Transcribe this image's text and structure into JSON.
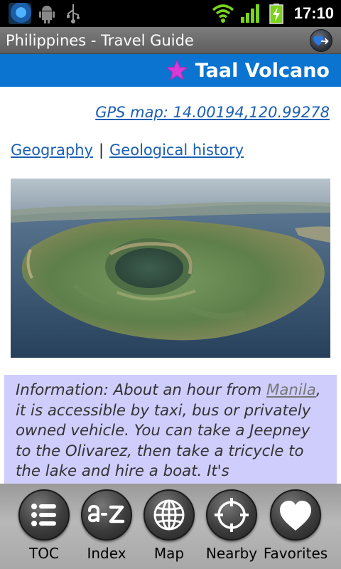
{
  "status_bar": {
    "time": "17:10",
    "icons": [
      "app-globe-icon",
      "android-debug-icon",
      "usb-icon",
      "wifi-icon",
      "signal-icon",
      "battery-charging-icon"
    ]
  },
  "app_bar": {
    "title": "Philippines - Travel Guide",
    "action_icon": "favorite-heart-toggle-icon"
  },
  "page": {
    "title": "Taal Volcano",
    "title_icon": "star-icon",
    "gps_link": "GPS map: 14.00194,120.99278",
    "section_links": [
      "Geography",
      "Geological history"
    ],
    "separator": "|",
    "photo_description": "aerial-island-volcano-photo",
    "info": {
      "prefix": "Information: About an hour from ",
      "link": "Manila",
      "suffix": ", it is accessible by taxi, bus or privately owned vehicle. You can take a Jeepney to the Olivarez, then take a tricycle to the lake and hire a boat. It's"
    }
  },
  "tabs": [
    {
      "label": "TOC",
      "icon": "list-icon"
    },
    {
      "label": "Index",
      "icon": "a-z-icon"
    },
    {
      "label": "Map",
      "icon": "globe-icon"
    },
    {
      "label": "Nearby",
      "icon": "crosshair-icon"
    },
    {
      "label": "Favorites",
      "icon": "heart-icon"
    }
  ],
  "colors": {
    "header_blue": "#0a74d0",
    "info_background": "#cfcdfb",
    "star_magenta": "#d63bd6",
    "link_blue": "#1a5fb4"
  }
}
